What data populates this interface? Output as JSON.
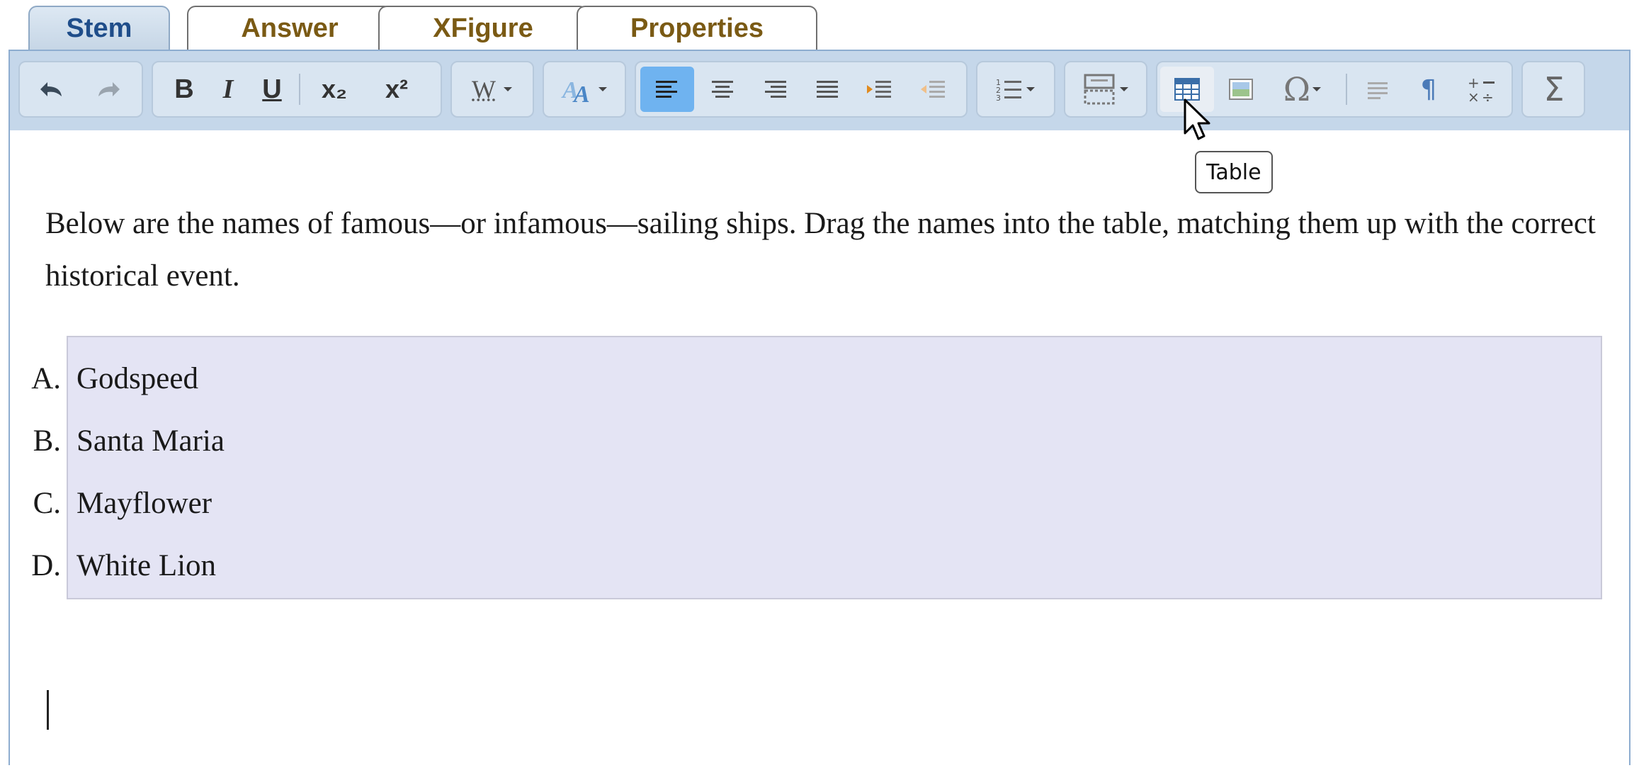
{
  "tabs": [
    "Stem",
    "Answer",
    "XFigure",
    "Properties"
  ],
  "active_tab": "Stem",
  "toolbar": {
    "undo_icon": "undo-icon",
    "redo_icon": "redo-icon",
    "bold_label": "B",
    "italic_label": "I",
    "underline_label": "U",
    "subscript_label": "x₂",
    "superscript_label": "x²",
    "word_label": "W",
    "active_color": "#6fb3f0",
    "table_tooltip": "Table"
  },
  "stem": {
    "text": "Below are the names of famous—or infamous—sailing ships. Drag the names into the table, matching them up with the correct historical event."
  },
  "options": [
    {
      "label": "A.",
      "text": "Godspeed"
    },
    {
      "label": "B.",
      "text": "Santa Maria"
    },
    {
      "label": "C.",
      "text": "Mayflower"
    },
    {
      "label": "D.",
      "text": "White Lion"
    }
  ],
  "colors": {
    "tab_text": "#7a5a14",
    "toolbar_bg": "#c5d7ea",
    "options_bg": "#e4e4f4"
  }
}
